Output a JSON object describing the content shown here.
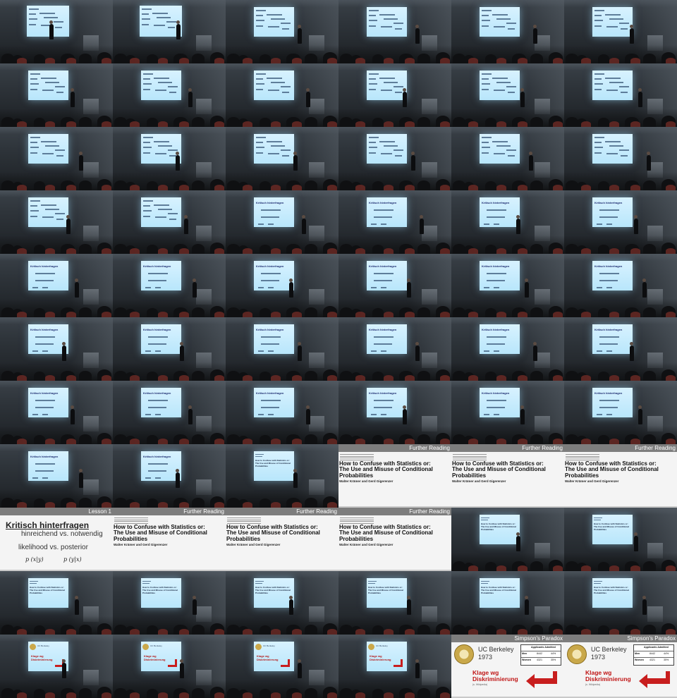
{
  "grid": {
    "columns": 6,
    "rows": 11
  },
  "cells": [
    {
      "kind": "photo",
      "cam": "cam1",
      "slide": "notes",
      "people": 2
    },
    {
      "kind": "photo",
      "cam": "cam1",
      "slide": "notes",
      "people": 2
    },
    {
      "kind": "photo",
      "cam": "cam2",
      "slide": "notes",
      "people": 1
    },
    {
      "kind": "photo",
      "cam": "cam2",
      "slide": "notes",
      "people": 1
    },
    {
      "kind": "photo",
      "cam": "cam2",
      "slide": "notes",
      "people": 1
    },
    {
      "kind": "photo",
      "cam": "cam2",
      "slide": "notes",
      "people": 1
    },
    {
      "kind": "photo",
      "cam": "cam2",
      "slide": "notes",
      "people": 1
    },
    {
      "kind": "photo",
      "cam": "cam2",
      "slide": "notes",
      "people": 1
    },
    {
      "kind": "photo",
      "cam": "cam2",
      "slide": "notes",
      "people": 1
    },
    {
      "kind": "photo",
      "cam": "cam2",
      "slide": "notes",
      "people": 1
    },
    {
      "kind": "photo",
      "cam": "cam2",
      "slide": "notes",
      "people": 1
    },
    {
      "kind": "photo",
      "cam": "cam2",
      "slide": "notes",
      "people": 1
    },
    {
      "kind": "photo",
      "cam": "cam2",
      "slide": "notes",
      "people": 1
    },
    {
      "kind": "photo",
      "cam": "cam2",
      "slide": "notes",
      "people": 1
    },
    {
      "kind": "photo",
      "cam": "cam2",
      "slide": "notes",
      "people": 1
    },
    {
      "kind": "photo",
      "cam": "cam2",
      "slide": "notes",
      "people": 1
    },
    {
      "kind": "photo",
      "cam": "cam2",
      "slide": "notes",
      "people": 1
    },
    {
      "kind": "photo",
      "cam": "cam2",
      "slide": "notes",
      "people": 1
    },
    {
      "kind": "photo",
      "cam": "cam2",
      "slide": "notes",
      "people": 1
    },
    {
      "kind": "photo",
      "cam": "cam2",
      "slide": "notes",
      "people": 1
    },
    {
      "kind": "photo",
      "cam": "cam2",
      "slide": "kritisch",
      "people": 1
    },
    {
      "kind": "photo",
      "cam": "cam2",
      "slide": "kritisch",
      "people": 1
    },
    {
      "kind": "photo",
      "cam": "cam2",
      "slide": "kritisch",
      "people": 1
    },
    {
      "kind": "photo",
      "cam": "cam2",
      "slide": "kritisch",
      "people": 1
    },
    {
      "kind": "photo",
      "cam": "cam2",
      "slide": "kritisch",
      "people": 1
    },
    {
      "kind": "photo",
      "cam": "cam2",
      "slide": "kritisch",
      "people": 1
    },
    {
      "kind": "photo",
      "cam": "cam2",
      "slide": "kritisch",
      "people": 1
    },
    {
      "kind": "photo",
      "cam": "cam2",
      "slide": "kritisch",
      "people": 1
    },
    {
      "kind": "photo",
      "cam": "cam2",
      "slide": "kritisch",
      "people": 1
    },
    {
      "kind": "photo",
      "cam": "cam2",
      "slide": "kritisch",
      "people": 1
    },
    {
      "kind": "photo",
      "cam": "cam2",
      "slide": "kritisch",
      "people": 1
    },
    {
      "kind": "photo",
      "cam": "cam2",
      "slide": "kritisch",
      "people": 1
    },
    {
      "kind": "photo",
      "cam": "cam2",
      "slide": "kritisch",
      "people": 1
    },
    {
      "kind": "photo",
      "cam": "cam2",
      "slide": "kritisch",
      "people": 1
    },
    {
      "kind": "photo",
      "cam": "cam2",
      "slide": "kritisch",
      "people": 1
    },
    {
      "kind": "photo",
      "cam": "cam2",
      "slide": "kritisch",
      "people": 1
    },
    {
      "kind": "photo",
      "cam": "cam2",
      "slide": "kritisch",
      "people": 1
    },
    {
      "kind": "photo",
      "cam": "cam2",
      "slide": "kritisch",
      "people": 1
    },
    {
      "kind": "photo",
      "cam": "cam2",
      "slide": "kritisch",
      "people": 1
    },
    {
      "kind": "photo",
      "cam": "cam2",
      "slide": "kritisch",
      "people": 1
    },
    {
      "kind": "photo",
      "cam": "cam2",
      "slide": "kritisch",
      "people": 1
    },
    {
      "kind": "photo",
      "cam": "cam2",
      "slide": "kritisch",
      "people": 1
    },
    {
      "kind": "photo",
      "cam": "cam2",
      "slide": "kritisch",
      "people": 1
    },
    {
      "kind": "photo",
      "cam": "cam2",
      "slide": "kritisch",
      "people": 1
    },
    {
      "kind": "photo",
      "cam": "cam2",
      "slide": "paper",
      "people": 1
    },
    {
      "kind": "paper"
    },
    {
      "kind": "paper"
    },
    {
      "kind": "paper"
    },
    {
      "kind": "lesson"
    },
    {
      "kind": "paper"
    },
    {
      "kind": "paper"
    },
    {
      "kind": "paper"
    },
    {
      "kind": "photo",
      "cam": "cam2",
      "slide": "paper",
      "people": 1
    },
    {
      "kind": "photo",
      "cam": "cam2",
      "slide": "paper",
      "people": 1
    },
    {
      "kind": "photo",
      "cam": "cam2",
      "slide": "paper",
      "people": 1
    },
    {
      "kind": "photo",
      "cam": "cam2",
      "slide": "paper",
      "people": 1
    },
    {
      "kind": "photo",
      "cam": "cam2",
      "slide": "paper",
      "people": 1
    },
    {
      "kind": "photo",
      "cam": "cam2",
      "slide": "paper",
      "people": 1
    },
    {
      "kind": "photo",
      "cam": "cam2",
      "slide": "paper",
      "people": 1
    },
    {
      "kind": "photo",
      "cam": "cam2",
      "slide": "paper",
      "people": 1
    },
    {
      "kind": "photo",
      "cam": "cam2",
      "slide": "berkeley",
      "people": 1
    },
    {
      "kind": "photo",
      "cam": "cam2",
      "slide": "berkeley",
      "people": 1
    },
    {
      "kind": "photo",
      "cam": "cam2",
      "slide": "berkeley",
      "people": 1
    },
    {
      "kind": "photo",
      "cam": "cam2",
      "slide": "berkeley",
      "people": 1
    },
    {
      "kind": "simpson"
    },
    {
      "kind": "simpson"
    }
  ],
  "projected": {
    "kritisch": "Kritisch hinterfragen",
    "paper": "How to Confuse with Statistics or: The Use and Misuse of Conditional Probabilities",
    "berkeley_title": "UC Berkeley",
    "berkeley_klage": "Klage wg Diskriminierung"
  },
  "paper_slide": {
    "header": "Further Reading",
    "title_line1": "How to Confuse with Statistics or:",
    "title_line2": "The Use and Misuse of Conditional",
    "title_line3": "Probabilities",
    "authors": "Walter Krämer and Gerd Gigerenzer"
  },
  "lesson_slide": {
    "header": "Lesson 1",
    "title": "Kritisch hinterfragen",
    "line1": "hinreichend vs. notwendig",
    "line2": "likelihood vs. posterior",
    "formula1": "p (x|y)",
    "formula2": "p (y|x)"
  },
  "simpson_slide": {
    "header": "Simpson's Paradox",
    "title": "UC Berkeley",
    "year": "1973",
    "table_header": "Applicants  Admitted",
    "row1_label": "Men",
    "row1_applicants": "8442",
    "row1_admitted": "44%",
    "row2_label": "Women",
    "row2_applicants": "4321",
    "row2_admitted": "35%",
    "klage_line1": "Klage wg",
    "klage_line2": "Diskriminierung",
    "klage_sub": "(s. Wikipedia)",
    "arrow_color": "#c81e1e"
  },
  "colors": {
    "slide_bar": "#7d7d7d",
    "screen_glow": "#c6ebfd",
    "klage_red": "#c01616"
  }
}
